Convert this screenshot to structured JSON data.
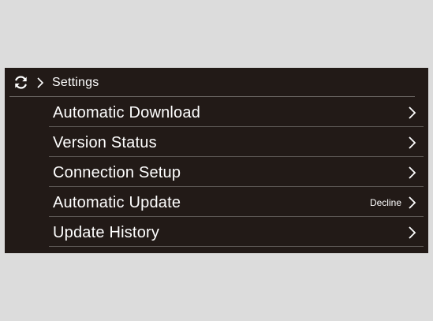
{
  "header": {
    "title": "Settings",
    "icons": [
      "refresh-icon",
      "chevron-right-icon"
    ]
  },
  "menu": [
    {
      "label": "Automatic Download",
      "value": ""
    },
    {
      "label": "Version Status",
      "value": ""
    },
    {
      "label": "Connection Setup",
      "value": ""
    },
    {
      "label": "Automatic Update",
      "value": "Decline"
    },
    {
      "label": "Update History",
      "value": ""
    }
  ],
  "colors": {
    "background": "#dcdcdc",
    "screen": "#221a17",
    "text": "#ffffff",
    "divider": "#5a5552"
  }
}
